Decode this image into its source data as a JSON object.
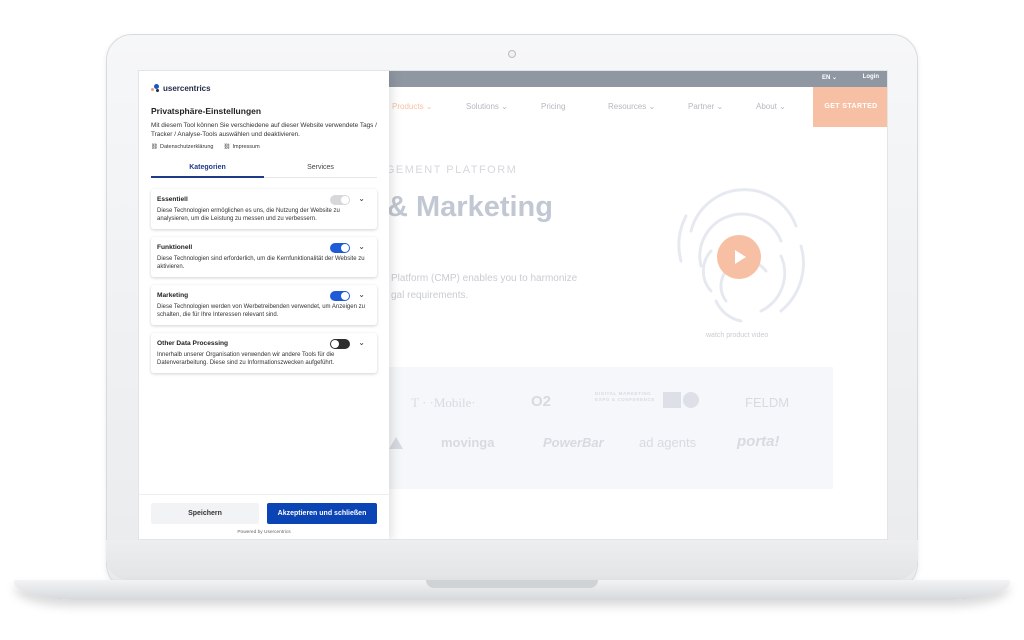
{
  "website": {
    "topbar": {
      "lang": "EN",
      "login": "Login"
    },
    "nav": [
      {
        "label": "Products",
        "active": true
      },
      {
        "label": "Solutions",
        "active": false
      },
      {
        "label": "Pricing",
        "active": false
      },
      {
        "label": "Resources",
        "active": false
      },
      {
        "label": "Partner",
        "active": false
      },
      {
        "label": "About",
        "active": false
      }
    ],
    "cta": "GET STARTED",
    "eyebrow": "AGEMENT PLATFORM",
    "headline": "& Marketing",
    "body_line1": "Platform (CMP) enables you to harmonize",
    "body_line2": "gal requirements.",
    "video_caption": "watch product video",
    "logos": [
      "T · ·Mobile·",
      "O2",
      "DIGITAL MARKETING EXPO & CONFERENCE",
      "FELDM",
      "movinga",
      "PowerBar",
      "ad agents",
      "porta!"
    ]
  },
  "consent": {
    "brand": "usercentrics",
    "title": "Privatsphäre-Einstellungen",
    "description": "Mit diesem Tool können Sie verschiedene auf dieser Website verwendete Tags / Tracker / Analyse-Tools auswählen und deaktivieren.",
    "links": [
      "Datenschutzerklärung",
      "Impressum"
    ],
    "tabs": [
      {
        "label": "Kategorien",
        "active": true
      },
      {
        "label": "Services",
        "active": false
      }
    ],
    "categories": [
      {
        "title": "Essentiell",
        "description": "Diese Technologien ermöglichen es uns, die Nutzung der Website zu analysieren, um die Leistung zu messen und zu verbessern.",
        "state": "disabled"
      },
      {
        "title": "Funktionell",
        "description": "Diese Technologien sind erforderlich, um die Kernfunktionalität der Website zu aktivieren.",
        "state": "on"
      },
      {
        "title": "Marketing",
        "description": "Diese Technologien werden von Werbetreibenden verwendet, um Anzeigen zu schalten, die für Ihre Interessen relevant sind.",
        "state": "on"
      },
      {
        "title": "Other Data Processing",
        "description": "Innerhalb unserer Organisation verwenden wir andere Tools für die Datenverarbeitung. Diese sind zu Informationszwecken aufgeführt.",
        "state": "off"
      }
    ],
    "save_label": "Speichern",
    "accept_label": "Akzeptieren und schließen",
    "powered_by": "Powered by Usercentrics"
  },
  "colors": {
    "accent": "#0b45b5",
    "toggle_on": "#1f5bd6",
    "brand_peach": "#f7c0a4"
  }
}
